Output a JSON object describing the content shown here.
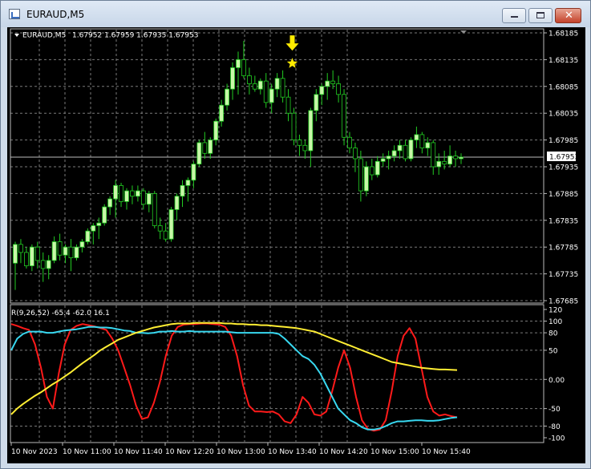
{
  "window": {
    "title": "EURAUD,M5",
    "close_glyph": "✕"
  },
  "price_header": {
    "symbol": "EURAUD,M5",
    "ohlc": "1.67952 1.67959 1.67935 1.67953"
  },
  "current_price_label": "1.67953",
  "indicator_label": "R(9,26,52) -65.4 -62.0 16.1",
  "colors": {
    "background": "#000000",
    "grid": "#7a7a7a",
    "candle": "#c8f7a8",
    "wick": "#22cc22",
    "signal": "#ffeb00",
    "line_red": "#ff1a1a",
    "line_cyan": "#38d8f0",
    "line_yellow": "#ffee33",
    "axis_text": "#ffffff"
  },
  "chart_data": [
    {
      "type": "candlestick",
      "title": "EURAUD,M5",
      "ylim": [
        1.67685,
        1.68185
      ],
      "y_ticks": [
        "1.68185",
        "1.68135",
        "1.68085",
        "1.68035",
        "1.67985",
        "1.67935",
        "1.67885",
        "1.67835",
        "1.67785",
        "1.67735",
        "1.67685"
      ],
      "y_tick_values": [
        1.68185,
        1.68135,
        1.68085,
        1.68035,
        1.67985,
        1.67935,
        1.67885,
        1.67835,
        1.67785,
        1.67735,
        1.67685
      ],
      "current_price": 1.67953,
      "signal": {
        "type": "sell-arrow-and-star",
        "bar_index": 50,
        "price": 1.68128
      },
      "candles": [
        {
          "o": 1.67755,
          "h": 1.67795,
          "l": 1.67705,
          "c": 1.6779
        },
        {
          "o": 1.6779,
          "h": 1.678,
          "l": 1.67755,
          "c": 1.67775
        },
        {
          "o": 1.67775,
          "h": 1.67785,
          "l": 1.67745,
          "c": 1.6775
        },
        {
          "o": 1.6775,
          "h": 1.6779,
          "l": 1.6774,
          "c": 1.67785
        },
        {
          "o": 1.67785,
          "h": 1.67795,
          "l": 1.67745,
          "c": 1.6776
        },
        {
          "o": 1.6776,
          "h": 1.67775,
          "l": 1.6772,
          "c": 1.67745
        },
        {
          "o": 1.67745,
          "h": 1.6777,
          "l": 1.67725,
          "c": 1.6776
        },
        {
          "o": 1.6776,
          "h": 1.67805,
          "l": 1.67755,
          "c": 1.67795
        },
        {
          "o": 1.67795,
          "h": 1.6781,
          "l": 1.6776,
          "c": 1.6777
        },
        {
          "o": 1.6777,
          "h": 1.6779,
          "l": 1.67755,
          "c": 1.67785
        },
        {
          "o": 1.67785,
          "h": 1.678,
          "l": 1.6774,
          "c": 1.67765
        },
        {
          "o": 1.67765,
          "h": 1.6779,
          "l": 1.6776,
          "c": 1.67785
        },
        {
          "o": 1.67785,
          "h": 1.678,
          "l": 1.67775,
          "c": 1.67795
        },
        {
          "o": 1.67795,
          "h": 1.6782,
          "l": 1.6779,
          "c": 1.67815
        },
        {
          "o": 1.67815,
          "h": 1.6783,
          "l": 1.6779,
          "c": 1.67825
        },
        {
          "o": 1.67825,
          "h": 1.6784,
          "l": 1.678,
          "c": 1.6783
        },
        {
          "o": 1.6783,
          "h": 1.67865,
          "l": 1.67825,
          "c": 1.6786
        },
        {
          "o": 1.6786,
          "h": 1.6788,
          "l": 1.67845,
          "c": 1.67875
        },
        {
          "o": 1.67875,
          "h": 1.6791,
          "l": 1.6784,
          "c": 1.679
        },
        {
          "o": 1.679,
          "h": 1.67905,
          "l": 1.6786,
          "c": 1.6787
        },
        {
          "o": 1.6787,
          "h": 1.67895,
          "l": 1.67855,
          "c": 1.6789
        },
        {
          "o": 1.6789,
          "h": 1.679,
          "l": 1.67865,
          "c": 1.6788
        },
        {
          "o": 1.6788,
          "h": 1.679,
          "l": 1.6787,
          "c": 1.6789
        },
        {
          "o": 1.6789,
          "h": 1.67895,
          "l": 1.67855,
          "c": 1.67865
        },
        {
          "o": 1.67865,
          "h": 1.6789,
          "l": 1.6785,
          "c": 1.67885
        },
        {
          "o": 1.67885,
          "h": 1.6789,
          "l": 1.6782,
          "c": 1.67825
        },
        {
          "o": 1.67825,
          "h": 1.6784,
          "l": 1.678,
          "c": 1.67815
        },
        {
          "o": 1.67815,
          "h": 1.6783,
          "l": 1.67795,
          "c": 1.678
        },
        {
          "o": 1.678,
          "h": 1.6786,
          "l": 1.67795,
          "c": 1.67855
        },
        {
          "o": 1.67855,
          "h": 1.67885,
          "l": 1.67835,
          "c": 1.6788
        },
        {
          "o": 1.6788,
          "h": 1.6791,
          "l": 1.6786,
          "c": 1.679
        },
        {
          "o": 1.679,
          "h": 1.67915,
          "l": 1.6787,
          "c": 1.6791
        },
        {
          "o": 1.6791,
          "h": 1.67945,
          "l": 1.67895,
          "c": 1.6794
        },
        {
          "o": 1.6794,
          "h": 1.67985,
          "l": 1.67935,
          "c": 1.6798
        },
        {
          "o": 1.6798,
          "h": 1.68,
          "l": 1.6795,
          "c": 1.6796
        },
        {
          "o": 1.6796,
          "h": 1.6799,
          "l": 1.6795,
          "c": 1.67985
        },
        {
          "o": 1.67985,
          "h": 1.68025,
          "l": 1.67975,
          "c": 1.6802
        },
        {
          "o": 1.6802,
          "h": 1.6806,
          "l": 1.6801,
          "c": 1.6805
        },
        {
          "o": 1.6805,
          "h": 1.6809,
          "l": 1.6804,
          "c": 1.6808
        },
        {
          "o": 1.6808,
          "h": 1.6813,
          "l": 1.6806,
          "c": 1.6812
        },
        {
          "o": 1.6812,
          "h": 1.6815,
          "l": 1.6807,
          "c": 1.68135
        },
        {
          "o": 1.68135,
          "h": 1.6817,
          "l": 1.681,
          "c": 1.68105
        },
        {
          "o": 1.68105,
          "h": 1.6812,
          "l": 1.6807,
          "c": 1.6809
        },
        {
          "o": 1.6809,
          "h": 1.68105,
          "l": 1.68075,
          "c": 1.6808
        },
        {
          "o": 1.6808,
          "h": 1.681,
          "l": 1.6807,
          "c": 1.68095
        },
        {
          "o": 1.68095,
          "h": 1.6811,
          "l": 1.68045,
          "c": 1.68055
        },
        {
          "o": 1.68055,
          "h": 1.6809,
          "l": 1.68035,
          "c": 1.6808
        },
        {
          "o": 1.6808,
          "h": 1.6811,
          "l": 1.68065,
          "c": 1.681
        },
        {
          "o": 1.681,
          "h": 1.68115,
          "l": 1.68055,
          "c": 1.68065
        },
        {
          "o": 1.68065,
          "h": 1.6808,
          "l": 1.6802,
          "c": 1.68035
        },
        {
          "o": 1.68035,
          "h": 1.68045,
          "l": 1.67975,
          "c": 1.67985
        },
        {
          "o": 1.67985,
          "h": 1.67995,
          "l": 1.67955,
          "c": 1.67975
        },
        {
          "o": 1.67975,
          "h": 1.67985,
          "l": 1.6795,
          "c": 1.67965
        },
        {
          "o": 1.67965,
          "h": 1.68045,
          "l": 1.67935,
          "c": 1.6804
        },
        {
          "o": 1.6804,
          "h": 1.6808,
          "l": 1.6802,
          "c": 1.6807
        },
        {
          "o": 1.6807,
          "h": 1.6809,
          "l": 1.6805,
          "c": 1.68085
        },
        {
          "o": 1.68085,
          "h": 1.6811,
          "l": 1.6806,
          "c": 1.68095
        },
        {
          "o": 1.68095,
          "h": 1.68115,
          "l": 1.6808,
          "c": 1.6809
        },
        {
          "o": 1.6809,
          "h": 1.68105,
          "l": 1.68055,
          "c": 1.6807
        },
        {
          "o": 1.6807,
          "h": 1.6808,
          "l": 1.67975,
          "c": 1.6799
        },
        {
          "o": 1.6799,
          "h": 1.68,
          "l": 1.6796,
          "c": 1.6797
        },
        {
          "o": 1.6797,
          "h": 1.6798,
          "l": 1.67925,
          "c": 1.6795
        },
        {
          "o": 1.6795,
          "h": 1.67965,
          "l": 1.6787,
          "c": 1.6789
        },
        {
          "o": 1.6789,
          "h": 1.67945,
          "l": 1.6788,
          "c": 1.67935
        },
        {
          "o": 1.67935,
          "h": 1.6795,
          "l": 1.6791,
          "c": 1.6792
        },
        {
          "o": 1.6792,
          "h": 1.67955,
          "l": 1.67915,
          "c": 1.67945
        },
        {
          "o": 1.67945,
          "h": 1.6796,
          "l": 1.67935,
          "c": 1.6795
        },
        {
          "o": 1.6795,
          "h": 1.67965,
          "l": 1.6793,
          "c": 1.67955
        },
        {
          "o": 1.67955,
          "h": 1.67975,
          "l": 1.67945,
          "c": 1.67965
        },
        {
          "o": 1.67965,
          "h": 1.67985,
          "l": 1.6795,
          "c": 1.67975
        },
        {
          "o": 1.67975,
          "h": 1.67985,
          "l": 1.67945,
          "c": 1.6795
        },
        {
          "o": 1.6795,
          "h": 1.6799,
          "l": 1.67945,
          "c": 1.67985
        },
        {
          "o": 1.67985,
          "h": 1.6801,
          "l": 1.6797,
          "c": 1.67995
        },
        {
          "o": 1.67995,
          "h": 1.68,
          "l": 1.6796,
          "c": 1.6797
        },
        {
          "o": 1.6797,
          "h": 1.6799,
          "l": 1.67955,
          "c": 1.6798
        },
        {
          "o": 1.6798,
          "h": 1.67985,
          "l": 1.6792,
          "c": 1.67935
        },
        {
          "o": 1.67935,
          "h": 1.6796,
          "l": 1.6792,
          "c": 1.67945
        },
        {
          "o": 1.67945,
          "h": 1.67965,
          "l": 1.6793,
          "c": 1.6794
        },
        {
          "o": 1.6794,
          "h": 1.67975,
          "l": 1.67935,
          "c": 1.67955
        },
        {
          "o": 1.67955,
          "h": 1.67965,
          "l": 1.67935,
          "c": 1.6795
        },
        {
          "o": 1.6795,
          "h": 1.6796,
          "l": 1.6794,
          "c": 1.67953
        }
      ]
    },
    {
      "type": "line",
      "title": "R(9,26,52)",
      "ylim": [
        -100,
        120
      ],
      "y_ticks": [
        "120",
        "100",
        "80",
        "50",
        "0.00",
        "-50",
        "-80",
        "-100"
      ],
      "y_tick_values": [
        120,
        100,
        80,
        50,
        0,
        -50,
        -80,
        -100
      ],
      "x_labels": [
        "10 Nov 2023",
        "10 Nov 11:00",
        "10 Nov 11:40",
        "10 Nov 12:20",
        "10 Nov 13:00",
        "10 Nov 13:40",
        "10 Nov 14:20",
        "10 Nov 15:00",
        "10 Nov 15:40"
      ],
      "series": [
        {
          "color": "#ff1a1a",
          "values": [
            95,
            92,
            88,
            85,
            60,
            20,
            -30,
            -50,
            10,
            60,
            85,
            92,
            95,
            93,
            91,
            88,
            85,
            70,
            50,
            20,
            -10,
            -45,
            -68,
            -65,
            -40,
            -5,
            40,
            75,
            90,
            94,
            95,
            95,
            96,
            96,
            95,
            94,
            90,
            75,
            40,
            -10,
            -45,
            -55,
            -55,
            -56,
            -55,
            -60,
            -72,
            -75,
            -60,
            -30,
            -40,
            -60,
            -62,
            -55,
            -20,
            20,
            50,
            20,
            -30,
            -70,
            -85,
            -88,
            -86,
            -70,
            -20,
            40,
            75,
            88,
            70,
            20,
            -30,
            -55,
            -62,
            -60,
            -63,
            -65
          ]
        },
        {
          "color": "#38d8f0",
          "values": [
            50,
            70,
            78,
            82,
            82,
            82,
            80,
            80,
            82,
            84,
            85,
            86,
            88,
            90,
            90,
            89,
            89,
            88,
            86,
            84,
            83,
            80,
            80,
            79,
            80,
            82,
            82,
            83,
            82,
            82,
            83,
            82,
            82,
            82,
            82,
            82,
            82,
            81,
            80,
            80,
            80,
            80,
            80,
            80,
            80,
            78,
            70,
            60,
            50,
            40,
            35,
            25,
            10,
            -10,
            -30,
            -50,
            -60,
            -70,
            -75,
            -82,
            -86,
            -86,
            -84,
            -80,
            -75,
            -72,
            -72,
            -71,
            -70,
            -70,
            -71,
            -71,
            -70,
            -68,
            -66,
            -65
          ]
        },
        {
          "color": "#ffee33",
          "values": [
            -60,
            -50,
            -42,
            -35,
            -28,
            -22,
            -15,
            -8,
            -2,
            5,
            12,
            20,
            28,
            35,
            42,
            50,
            56,
            62,
            68,
            72,
            76,
            80,
            83,
            86,
            89,
            91,
            93,
            95,
            96,
            96,
            96,
            97,
            97,
            97,
            97,
            97,
            96,
            96,
            95,
            95,
            94,
            94,
            93,
            93,
            92,
            91,
            90,
            89,
            88,
            86,
            84,
            82,
            78,
            74,
            70,
            66,
            62,
            58,
            54,
            50,
            46,
            42,
            38,
            34,
            30,
            28,
            26,
            24,
            22,
            20,
            19,
            18,
            17,
            17,
            16.5,
            16.1
          ]
        }
      ]
    }
  ]
}
